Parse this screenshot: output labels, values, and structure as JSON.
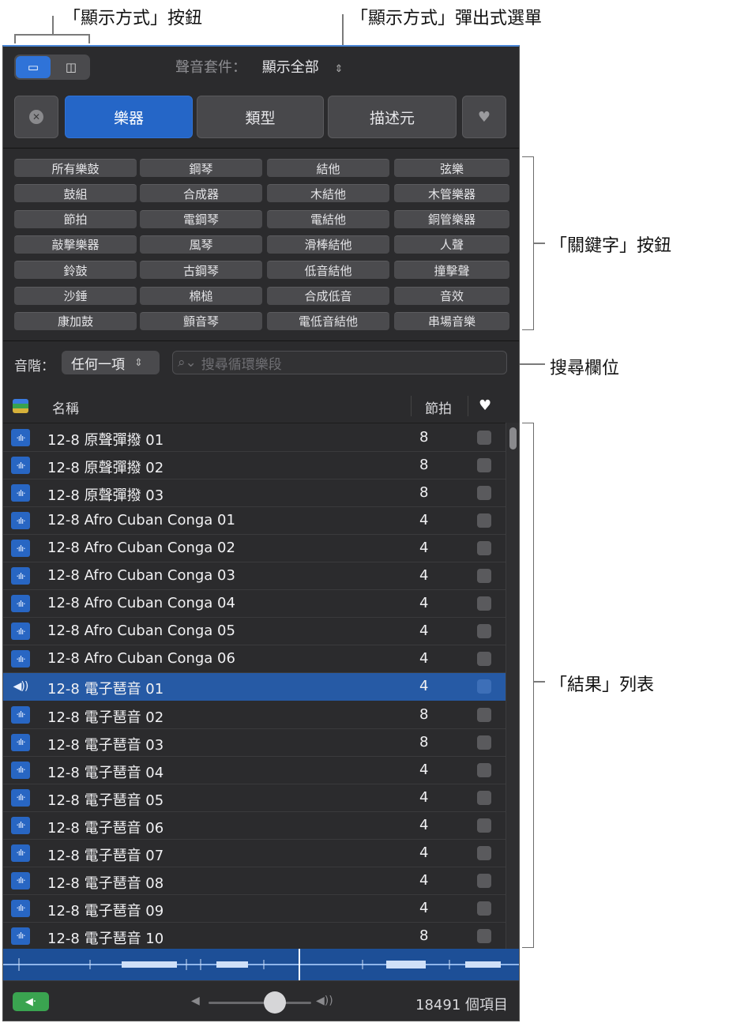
{
  "callouts": {
    "view_buttons": "「顯示方式」按鈕",
    "view_popup": "「顯示方式」彈出式選單",
    "keyword_buttons": "「關鍵字」按鈕",
    "search_field": "搜尋欄位",
    "results_list": "「結果」列表"
  },
  "toolbar": {
    "library_label": "聲音套件：",
    "library_value": "顯示全部",
    "chevron": "⌃⌄"
  },
  "tabs": {
    "reset_icon": "reset-icon",
    "instrument": "樂器",
    "genre": "類型",
    "descriptors": "描述元",
    "favorites_icon": "heart-icon"
  },
  "keywords": [
    [
      "所有樂鼓",
      "鋼琴",
      "結他",
      "弦樂"
    ],
    [
      "鼓組",
      "合成器",
      "木結他",
      "木管樂器"
    ],
    [
      "節拍",
      "電鋼琴",
      "電結他",
      "銅管樂器"
    ],
    [
      "敲擊樂器",
      "風琴",
      "滑棒結他",
      "人聲"
    ],
    [
      "鈴鼓",
      "古鋼琴",
      "低音結他",
      "撞擊聲"
    ],
    [
      "沙錘",
      "棉槌",
      "合成低音",
      "音效"
    ],
    [
      "康加鼓",
      "顫音琴",
      "電低音結他",
      "串場音樂"
    ]
  ],
  "scale": {
    "label": "音階：",
    "value": "任何一項"
  },
  "search": {
    "placeholder": "搜尋循環樂段",
    "icon": "search-icon"
  },
  "table": {
    "col_name": "名稱",
    "col_beats": "節拍",
    "rows": [
      {
        "name": "12-8 原聲彈撥 01",
        "beats": "8"
      },
      {
        "name": "12-8 原聲彈撥 02",
        "beats": "8"
      },
      {
        "name": "12-8 原聲彈撥 03",
        "beats": "8"
      },
      {
        "name": "12-8 Afro Cuban Conga 01",
        "beats": "4"
      },
      {
        "name": "12-8 Afro Cuban Conga 02",
        "beats": "4"
      },
      {
        "name": "12-8 Afro Cuban Conga 03",
        "beats": "4"
      },
      {
        "name": "12-8 Afro Cuban Conga 04",
        "beats": "4"
      },
      {
        "name": "12-8 Afro Cuban Conga 05",
        "beats": "4"
      },
      {
        "name": "12-8 Afro Cuban Conga 06",
        "beats": "4"
      },
      {
        "name": "12-8 電子琶音 01",
        "beats": "4",
        "selected": true
      },
      {
        "name": "12-8 電子琶音 02",
        "beats": "8"
      },
      {
        "name": "12-8 電子琶音 03",
        "beats": "8"
      },
      {
        "name": "12-8 電子琶音 04",
        "beats": "4"
      },
      {
        "name": "12-8 電子琶音 05",
        "beats": "4"
      },
      {
        "name": "12-8 電子琶音 06",
        "beats": "4"
      },
      {
        "name": "12-8 電子琶音 07",
        "beats": "4"
      },
      {
        "name": "12-8 電子琶音 08",
        "beats": "4"
      },
      {
        "name": "12-8 電子琶音 09",
        "beats": "4"
      },
      {
        "name": "12-8 電子琶音 10",
        "beats": "8"
      }
    ]
  },
  "footer": {
    "count": "18491 個項目"
  },
  "colors": {
    "accent": "#2566c7",
    "selection": "#265aa5",
    "speaker": "#3aa450"
  }
}
